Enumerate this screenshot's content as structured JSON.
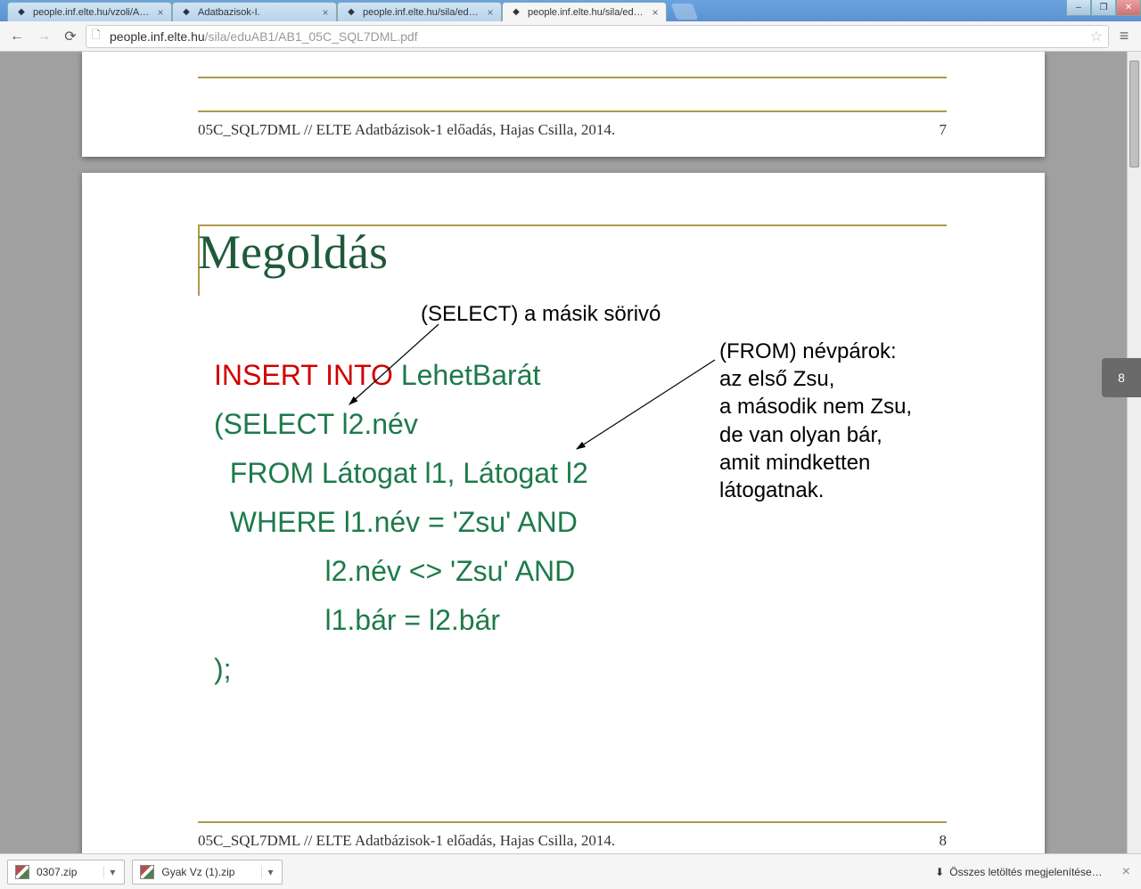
{
  "tabs": [
    {
      "title": "people.inf.elte.hu/vzoli/Adat"
    },
    {
      "title": "Adatbazisok-I."
    },
    {
      "title": "people.inf.elte.hu/sila/eduAB"
    },
    {
      "title": "people.inf.elte.hu/sila/eduAB"
    }
  ],
  "activeTab": 3,
  "url": {
    "host": "people.inf.elte.hu",
    "path": "/sila/eduAB1/AB1_05C_SQL7DML.pdf"
  },
  "pageIndicator": "8",
  "prevSlide": {
    "footer_left": "05C_SQL7DML // ELTE Adatbázisok-1 előadás, Hajas Csilla, 2014.",
    "footer_right": "7"
  },
  "slide": {
    "title": "Megoldás",
    "annot1": "(SELECT) a másik sörivó",
    "annot2": "(FROM) névpárok:\naz első Zsu,\na második nem Zsu,\nde van olyan bár,\namit mindketten\nlátogatnak.",
    "sql_kw": "INSERT INTO",
    "sql_rest": " LehetBarát\n(SELECT l2.név\n  FROM Látogat l1, Látogat l2\n  WHERE l1.név = 'Zsu' AND\n              l2.név <> 'Zsu' AND\n              l1.bár = l2.bár\n);",
    "footer_left": "05C_SQL7DML // ELTE Adatbázisok-1 előadás, Hajas Csilla, 2014.",
    "footer_right": "8"
  },
  "downloads": {
    "items": [
      {
        "name": "0307.zip"
      },
      {
        "name": "Gyak Vz (1).zip"
      }
    ],
    "showall": "Összes letöltés megjelenítése…"
  }
}
